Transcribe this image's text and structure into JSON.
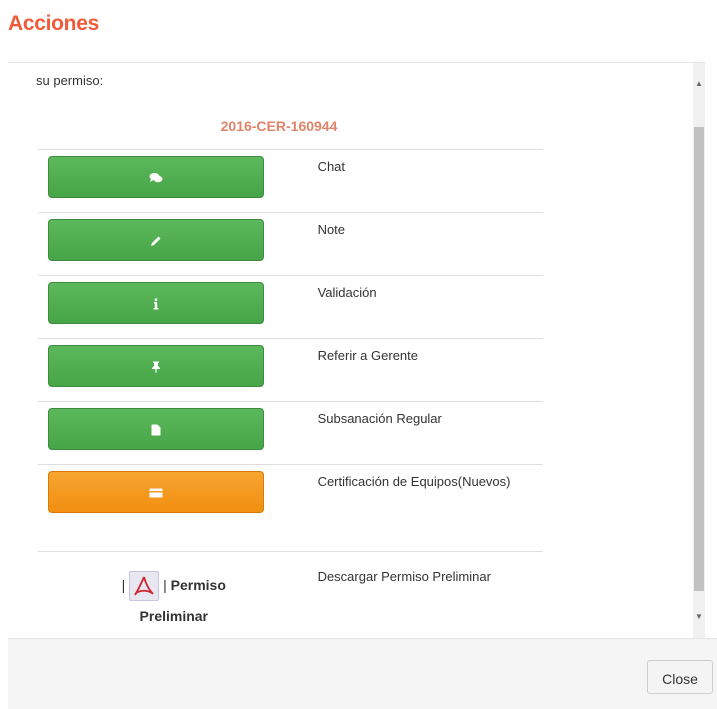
{
  "modal": {
    "title": "Acciones",
    "intro": "su permiso:",
    "permit_number": "2016-CER-160944",
    "close_label": "Close"
  },
  "actions": [
    {
      "label": "Chat",
      "icon": "chat-icon",
      "color": "#46a546"
    },
    {
      "label": "Note",
      "icon": "pencil-icon",
      "color": "#46a546"
    },
    {
      "label": "Validación",
      "icon": "info-icon",
      "color": "#46a546"
    },
    {
      "label": "Referir a Gerente",
      "icon": "pin-icon",
      "color": "#46a546"
    },
    {
      "label": "Subsanación Regular",
      "icon": "document-icon",
      "color": "#46a546"
    },
    {
      "label": "Certificación de Equipos(Nuevos)",
      "icon": "card-icon",
      "color": "#f18f10"
    }
  ],
  "pdf_row": {
    "sep_left": "|",
    "sep_right": "|",
    "link_line1": "Permiso",
    "link_line2": "Preliminar",
    "label": "Descargar Permiso Preliminar"
  }
}
